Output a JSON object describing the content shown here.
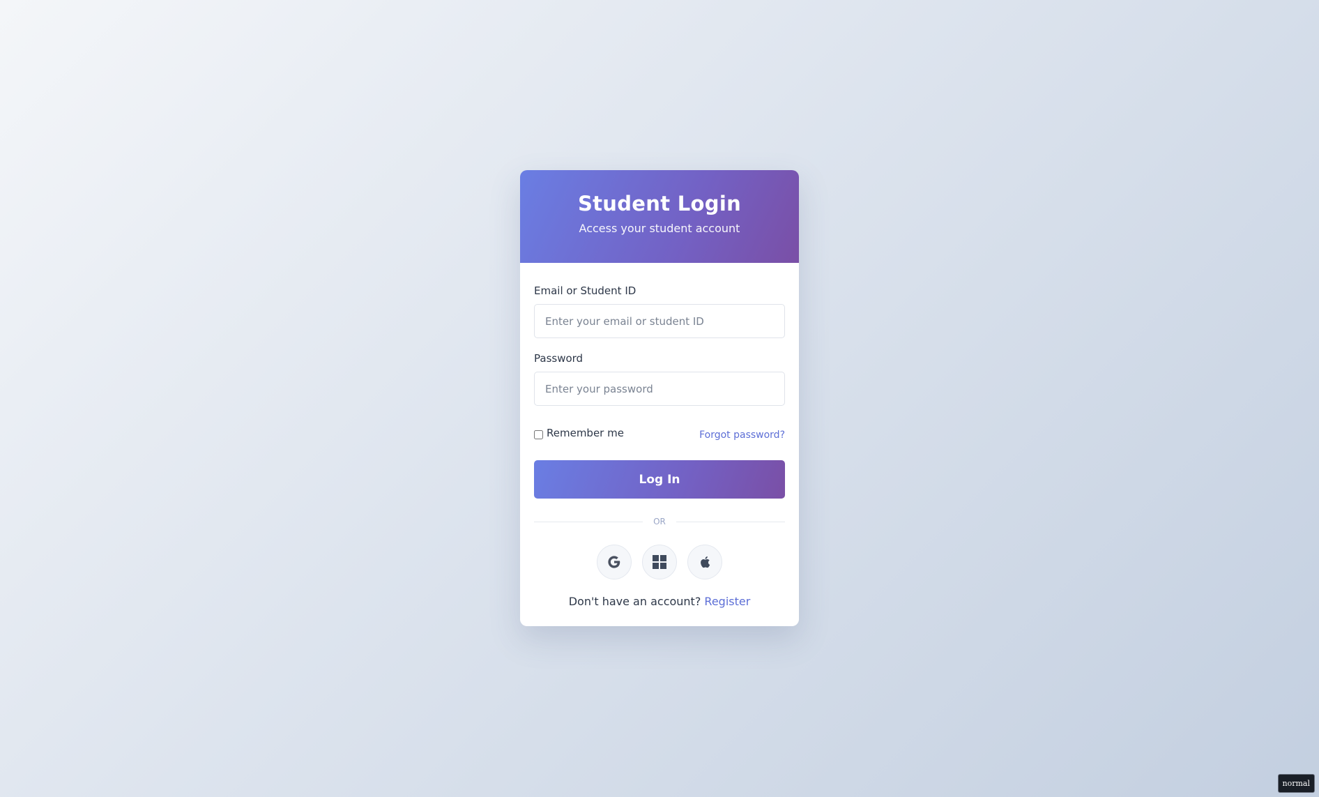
{
  "header": {
    "title": "Student Login",
    "subtitle": "Access your student account"
  },
  "form": {
    "email_label": "Email or Student ID",
    "email_placeholder": "Enter your email or student ID",
    "email_value": "",
    "password_label": "Password",
    "password_placeholder": "Enter your password",
    "password_value": "",
    "remember_label": "Remember me",
    "remember_checked": false,
    "forgot_label": "Forgot password?",
    "submit_label": "Log In"
  },
  "divider": {
    "label": "OR"
  },
  "social": [
    {
      "icon": "google-icon"
    },
    {
      "icon": "windows-icon"
    },
    {
      "icon": "apple-icon"
    }
  ],
  "footer": {
    "prompt": "Don't have an account?",
    "register_label": "Register"
  },
  "badge": {
    "label": "normal"
  },
  "colors": {
    "accent": "#5c6ed6",
    "gradient_start": "#6a7ee3",
    "gradient_end": "#7a4fa6",
    "text": "#2d3748"
  }
}
